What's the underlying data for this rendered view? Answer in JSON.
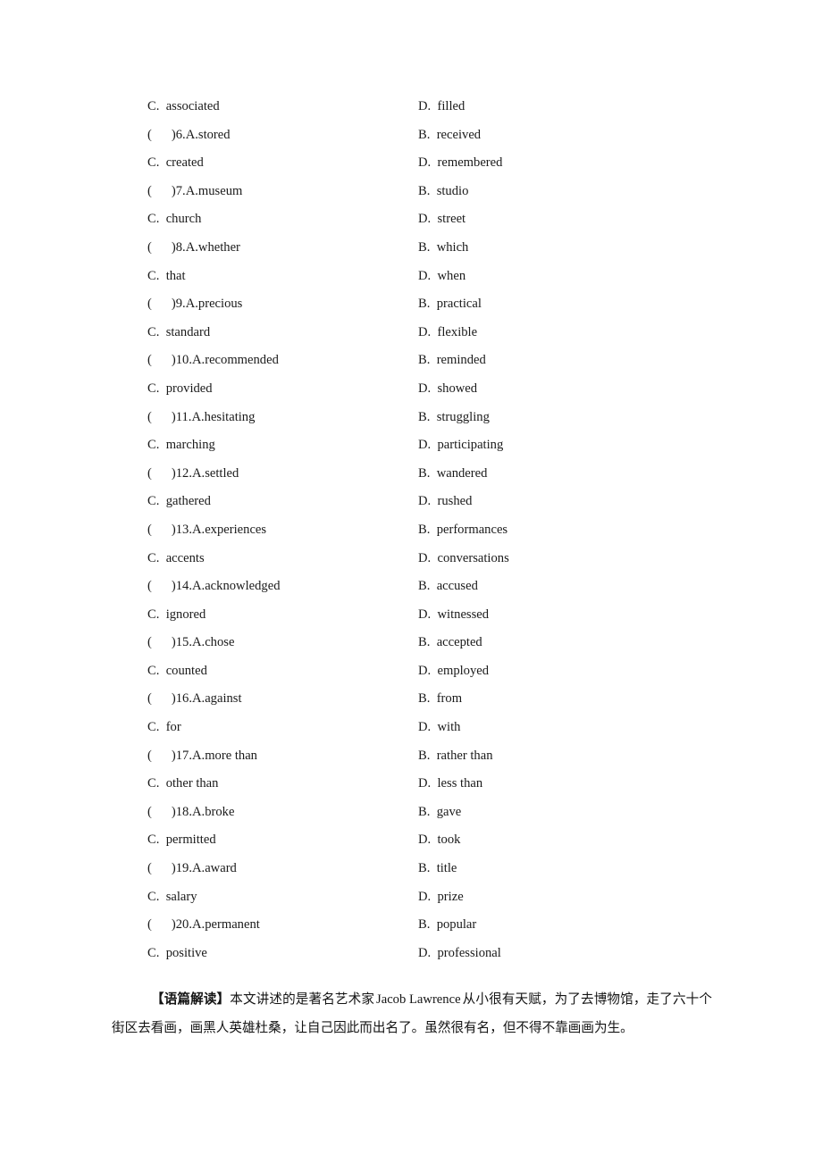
{
  "document": {
    "type": "exam-answer-options-page",
    "columns": 2
  },
  "options": [
    {
      "left": {
        "label": "C.",
        "text": "associated"
      },
      "right": {
        "label": "D.",
        "text": "filled"
      }
    },
    {
      "left": {
        "bracket": true,
        "num": "6.",
        "label": "A.",
        "text": "stored"
      },
      "right": {
        "label": "B.",
        "text": "received"
      }
    },
    {
      "left": {
        "label": "C.",
        "text": "created"
      },
      "right": {
        "label": "D.",
        "text": "remembered"
      }
    },
    {
      "left": {
        "bracket": true,
        "num": "7.",
        "label": "A.",
        "text": "museum"
      },
      "right": {
        "label": "B.",
        "text": "studio"
      }
    },
    {
      "left": {
        "label": "C.",
        "text": "church"
      },
      "right": {
        "label": "D.",
        "text": "street"
      }
    },
    {
      "left": {
        "bracket": true,
        "num": "8.",
        "label": "A.",
        "text": "whether"
      },
      "right": {
        "label": "B.",
        "text": "which"
      }
    },
    {
      "left": {
        "label": "C.",
        "text": "that"
      },
      "right": {
        "label": "D.",
        "text": "when"
      }
    },
    {
      "left": {
        "bracket": true,
        "num": "9.",
        "label": "A.",
        "text": "precious"
      },
      "right": {
        "label": "B.",
        "text": "practical"
      }
    },
    {
      "left": {
        "label": "C.",
        "text": "standard"
      },
      "right": {
        "label": "D.",
        "text": "flexible"
      }
    },
    {
      "left": {
        "bracket": true,
        "num": "10.",
        "label": "A.",
        "text": "recommended"
      },
      "right": {
        "label": "B.",
        "text": "reminded"
      }
    },
    {
      "left": {
        "label": "C.",
        "text": "provided"
      },
      "right": {
        "label": "D.",
        "text": "showed"
      }
    },
    {
      "left": {
        "bracket": true,
        "num": "11.",
        "label": "A.",
        "text": "hesitating"
      },
      "right": {
        "label": "B.",
        "text": "struggling"
      }
    },
    {
      "left": {
        "label": "C.",
        "text": "marching"
      },
      "right": {
        "label": "D.",
        "text": "participating"
      }
    },
    {
      "left": {
        "bracket": true,
        "num": "12.",
        "label": "A.",
        "text": "settled"
      },
      "right": {
        "label": "B.",
        "text": "wandered"
      }
    },
    {
      "left": {
        "label": "C.",
        "text": "gathered"
      },
      "right": {
        "label": "D.",
        "text": "rushed"
      }
    },
    {
      "left": {
        "bracket": true,
        "num": "13.",
        "label": "A.",
        "text": "experiences"
      },
      "right": {
        "label": "B.",
        "text": "performances"
      }
    },
    {
      "left": {
        "label": "C.",
        "text": "accents"
      },
      "right": {
        "label": "D.",
        "text": "conversations"
      }
    },
    {
      "left": {
        "bracket": true,
        "num": "14.",
        "label": "A.",
        "text": "acknowledged"
      },
      "right": {
        "label": "B.",
        "text": "accused"
      }
    },
    {
      "left": {
        "label": "C.",
        "text": "ignored"
      },
      "right": {
        "label": "D.",
        "text": "witnessed"
      }
    },
    {
      "left": {
        "bracket": true,
        "num": "15.",
        "label": "A.",
        "text": "chose"
      },
      "right": {
        "label": "B.",
        "text": "accepted"
      }
    },
    {
      "left": {
        "label": "C.",
        "text": "counted"
      },
      "right": {
        "label": "D.",
        "text": "employed"
      }
    },
    {
      "left": {
        "bracket": true,
        "num": "16.",
        "label": "A.",
        "text": "against"
      },
      "right": {
        "label": "B.",
        "text": "from"
      }
    },
    {
      "left": {
        "label": "C.",
        "text": "for"
      },
      "right": {
        "label": "D.",
        "text": "with"
      }
    },
    {
      "left": {
        "bracket": true,
        "num": "17.",
        "label": "A.",
        "text": "more than"
      },
      "right": {
        "label": "B.",
        "text": "rather than"
      }
    },
    {
      "left": {
        "label": "C.",
        "text": "other than"
      },
      "right": {
        "label": "D.",
        "text": "less than"
      }
    },
    {
      "left": {
        "bracket": true,
        "num": "18.",
        "label": "A.",
        "text": "broke"
      },
      "right": {
        "label": "B.",
        "text": "gave"
      }
    },
    {
      "left": {
        "label": "C.",
        "text": "permitted"
      },
      "right": {
        "label": "D.",
        "text": "took"
      }
    },
    {
      "left": {
        "bracket": true,
        "num": "19.",
        "label": "A.",
        "text": "award"
      },
      "right": {
        "label": "B.",
        "text": "title"
      }
    },
    {
      "left": {
        "label": "C.",
        "text": "salary"
      },
      "right": {
        "label": "D.",
        "text": "prize"
      }
    },
    {
      "left": {
        "bracket": true,
        "num": "20.",
        "label": "A.",
        "text": "permanent"
      },
      "right": {
        "label": "B.",
        "text": "popular"
      }
    },
    {
      "left": {
        "label": "C.",
        "text": "positive"
      },
      "right": {
        "label": "D.",
        "text": "professional"
      }
    }
  ],
  "analysis": {
    "tag": "【语篇解读】",
    "part1": "本文讲述的是著名艺术家",
    "name": "Jacob Lawrence",
    "part2": "从小很有天赋，为了去博物馆，走了六十个街区去看画，画黑人英雄杜桑，让自己因此而出名了。虽然很有名，但不得不靠画画为生。"
  }
}
